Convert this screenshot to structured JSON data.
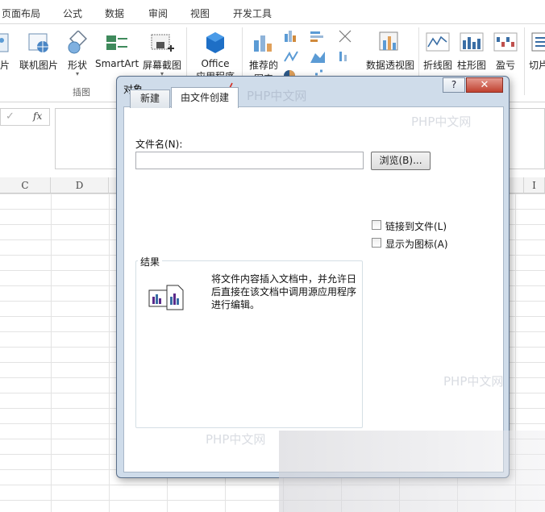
{
  "ribbon_tabs": [
    "页面布局",
    "公式",
    "数据",
    "审阅",
    "视图",
    "开发工具"
  ],
  "ribbon_buttons": {
    "picture": "片",
    "online_picture": "联机图片",
    "shapes": "形状",
    "smartart": "SmartArt",
    "screenshot": "屏幕截图",
    "office_apps": "Office",
    "office_apps_sub": "应用程序",
    "recommended_charts": "推荐的",
    "recommended_charts_sub": "图表",
    "pivot_chart": "数据透视图",
    "line_spark": "折线图",
    "column_spark": "柱形图",
    "winloss_spark": "盈亏",
    "slicer": "切片"
  },
  "group_labels": {
    "illustrations": "插图"
  },
  "formula_bar": {
    "check": "✓",
    "fx": "fx"
  },
  "columns": [
    "C",
    "D",
    "I"
  ],
  "dialog": {
    "title": "对象",
    "help": "?",
    "close": "✕",
    "tabs": [
      "新建",
      "由文件创建"
    ],
    "filename_label": "文件名(N):",
    "filename_value": "",
    "browse_button": "浏览(B)...",
    "link_to_file": "链接到文件(L)",
    "display_as_icon": "显示为图标(A)",
    "result_title": "结果",
    "result_desc": "将文件内容插入文档中，并允许日后直接在该文档中调用源应用程序进行编辑。"
  },
  "watermark": "PHP中文网"
}
